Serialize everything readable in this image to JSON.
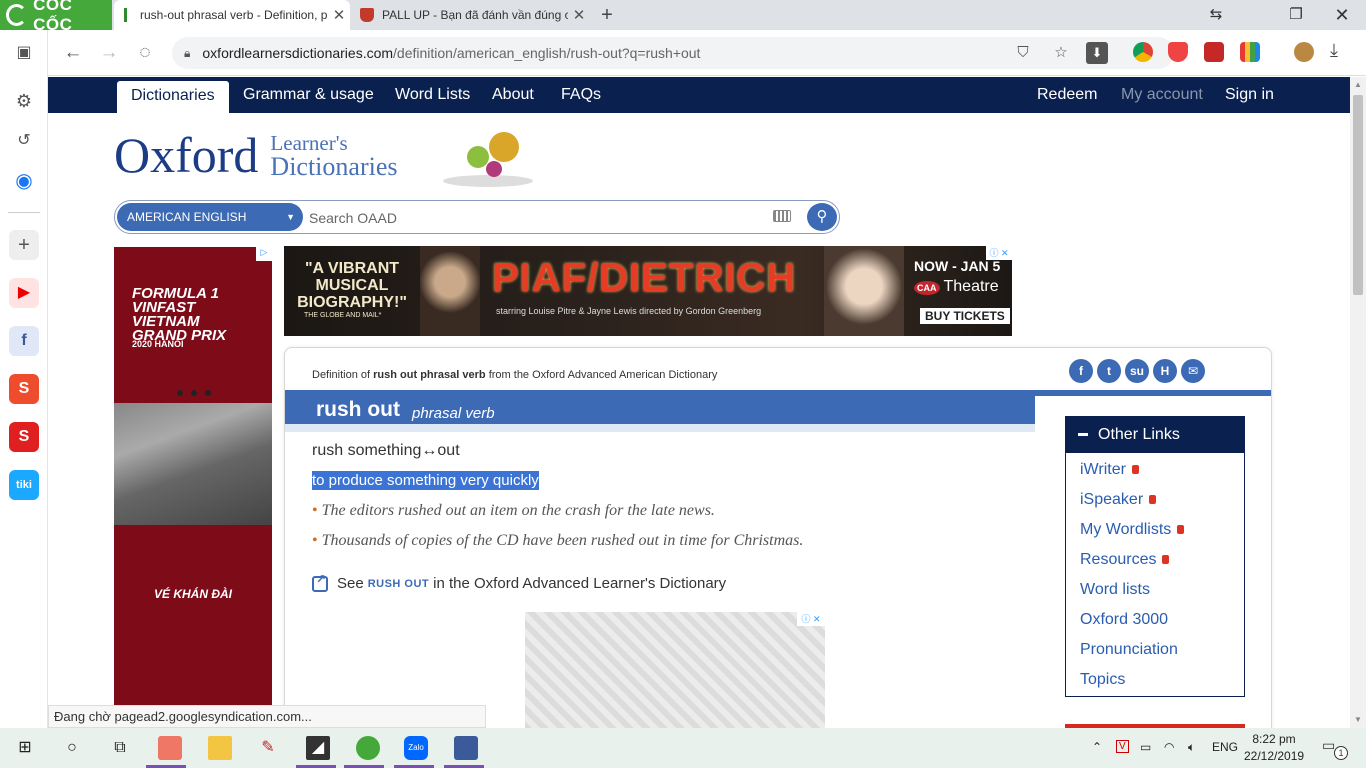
{
  "browser": {
    "brand": "CỐC CỐC",
    "tabs": [
      {
        "title": "rush-out phrasal verb - Definition, pictures,",
        "close": "✕"
      },
      {
        "title": "PALL UP - Bạn đã đánh vần đúng chưa?",
        "close": "✕"
      }
    ],
    "new_tab": "+",
    "url_host": "oxfordlearnersdictionaries.com",
    "url_path": "/definition/american_english/rush-out?q=rush+out",
    "status_text": "Đang chờ pagead2.googlesyndication.com..."
  },
  "site_nav": {
    "items": [
      "Dictionaries",
      "Grammar & usage",
      "Word Lists",
      "About",
      "FAQs"
    ],
    "right": [
      "Redeem",
      "My account",
      "Sign in"
    ]
  },
  "logo": {
    "oxford": "Oxford",
    "learners": "Learner's",
    "dictionaries": "Dictionaries"
  },
  "search": {
    "dictionary": "AMERICAN ENGLISH",
    "placeholder": "Search OAAD"
  },
  "ads": {
    "left": {
      "headline": "FORMULA 1 VINFAST VIETNAM GRAND PRIX",
      "year": "2020 HANOI",
      "cta": "VÉ KHÁN ĐÀI"
    },
    "top": {
      "quote": "\"A VIBRANT MUSICAL BIOGRAPHY!\"",
      "quote_src": "THE GLOBE AND MAIL*",
      "title": "PIAF/DIETRICH",
      "credits": "starring Louise Pitre & Jayne Lewis   directed by Gordon Greenberg",
      "dates": "NOW - JAN 5",
      "venue": "Theatre",
      "venue_badge": "CAA",
      "tickets": "BUY TICKETS"
    }
  },
  "entry": {
    "definition_prefix": "Definition of",
    "definition_word": "rush out phrasal verb",
    "definition_suffix": "from the Oxford Advanced American Dictionary",
    "headword": "rush out",
    "pos": "phrasal verb",
    "sense_cf": "rush something↔out",
    "definition": "to produce something very quickly",
    "examples": [
      "The editors rushed out an item on the crash for the late news.",
      "Thousands of copies of the CD have been rushed out in time for Christmas."
    ],
    "see_prefix": "See",
    "see_word": "RUSH OUT",
    "see_suffix": "in the Oxford Advanced Learner's Dictionary"
  },
  "other_links": {
    "title": "Other Links",
    "items": [
      "iWriter",
      "iSpeaker",
      "My Wordlists",
      "Resources",
      "Word lists",
      "Oxford 3000",
      "Pronunciation",
      "Topics"
    ],
    "locked": [
      true,
      true,
      true,
      true,
      false,
      false,
      false,
      false
    ]
  },
  "taskbar": {
    "lang": "ENG",
    "time": "8:22 pm",
    "date": "22/12/2019",
    "notifications": "1"
  },
  "colors": {
    "navy": "#0a2150",
    "oxford_blue": "#3c6ab4",
    "bullet_orange": "#d46a1c",
    "coccoc_green": "#44a83b"
  }
}
